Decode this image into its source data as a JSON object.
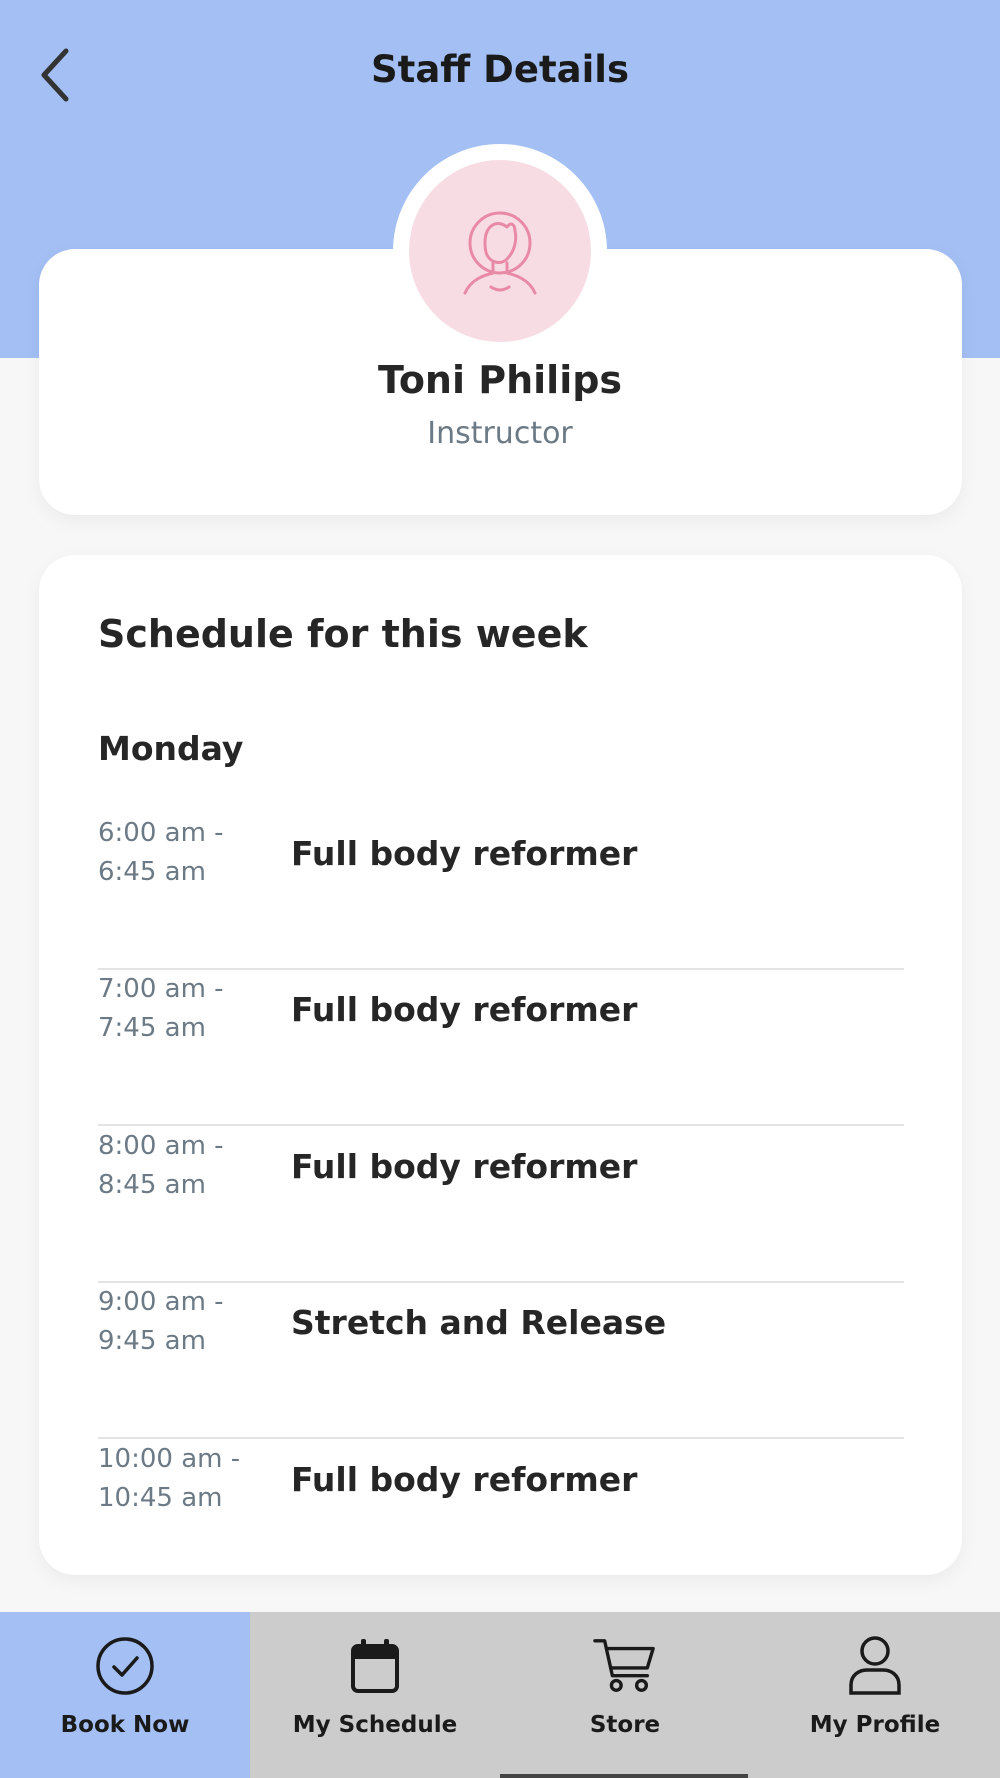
{
  "header": {
    "title": "Staff Details",
    "back_icon": "chevron-left-icon"
  },
  "staff": {
    "name": "Toni Philips",
    "role": "Instructor",
    "avatar_icon": "person-avatar-icon"
  },
  "schedule": {
    "title": "Schedule for this week",
    "days": [
      {
        "day": "Monday",
        "classes": [
          {
            "time": "6:00 am -\n6:45 am",
            "name": "Full body reformer"
          },
          {
            "time": "7:00 am -\n7:45 am",
            "name": "Full body reformer"
          },
          {
            "time": "8:00 am -\n8:45 am",
            "name": "Full body reformer"
          },
          {
            "time": "9:00 am -\n9:45 am",
            "name": "Stretch and Release"
          },
          {
            "time": "10:00 am -\n10:45 am",
            "name": "Full body reformer"
          }
        ]
      }
    ]
  },
  "nav": {
    "items": [
      {
        "label": "Book Now",
        "icon": "check-circle-icon",
        "active": true
      },
      {
        "label": "My Schedule",
        "icon": "calendar-icon",
        "active": false
      },
      {
        "label": "Store",
        "icon": "cart-icon",
        "active": false
      },
      {
        "label": "My Profile",
        "icon": "user-icon",
        "active": false
      }
    ]
  },
  "colors": {
    "header_bg": "#a3bff3",
    "avatar_bg": "#f8dce4",
    "avatar_stroke": "#e88aa6",
    "nav_bg": "#cccccc"
  }
}
